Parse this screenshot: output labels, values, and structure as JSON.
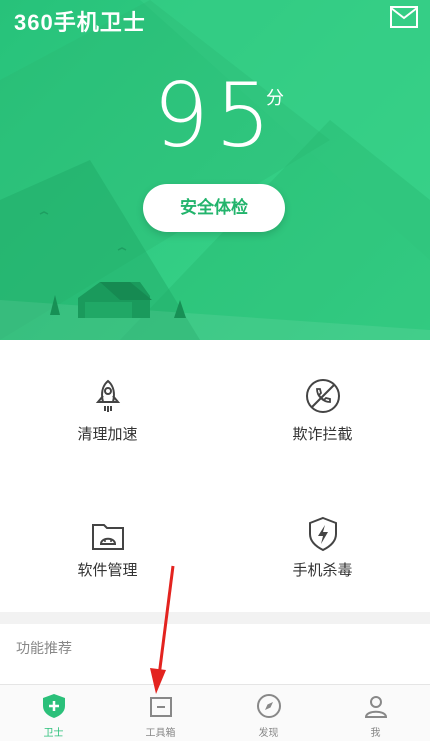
{
  "header": {
    "app_title": "360手机卫士"
  },
  "score": {
    "value": "95",
    "unit": "分"
  },
  "check_button": {
    "label": "安全体检"
  },
  "features": [
    {
      "label": "清理加速",
      "icon": "rocket-icon"
    },
    {
      "label": "欺诈拦截",
      "icon": "phone-block-icon"
    },
    {
      "label": "软件管理",
      "icon": "android-folder-icon"
    },
    {
      "label": "手机杀毒",
      "icon": "shield-bolt-icon"
    }
  ],
  "recommend": {
    "title": "功能推荐"
  },
  "tabs": [
    {
      "label": "卫士",
      "icon": "shield-plus-icon",
      "active": true
    },
    {
      "label": "工具箱",
      "icon": "toolbox-icon",
      "active": false
    },
    {
      "label": "发现",
      "icon": "compass-icon",
      "active": false
    },
    {
      "label": "我",
      "icon": "person-icon",
      "active": false
    }
  ],
  "colors": {
    "brand_green": "#2bc07a",
    "arrow_red": "#e3231f"
  }
}
